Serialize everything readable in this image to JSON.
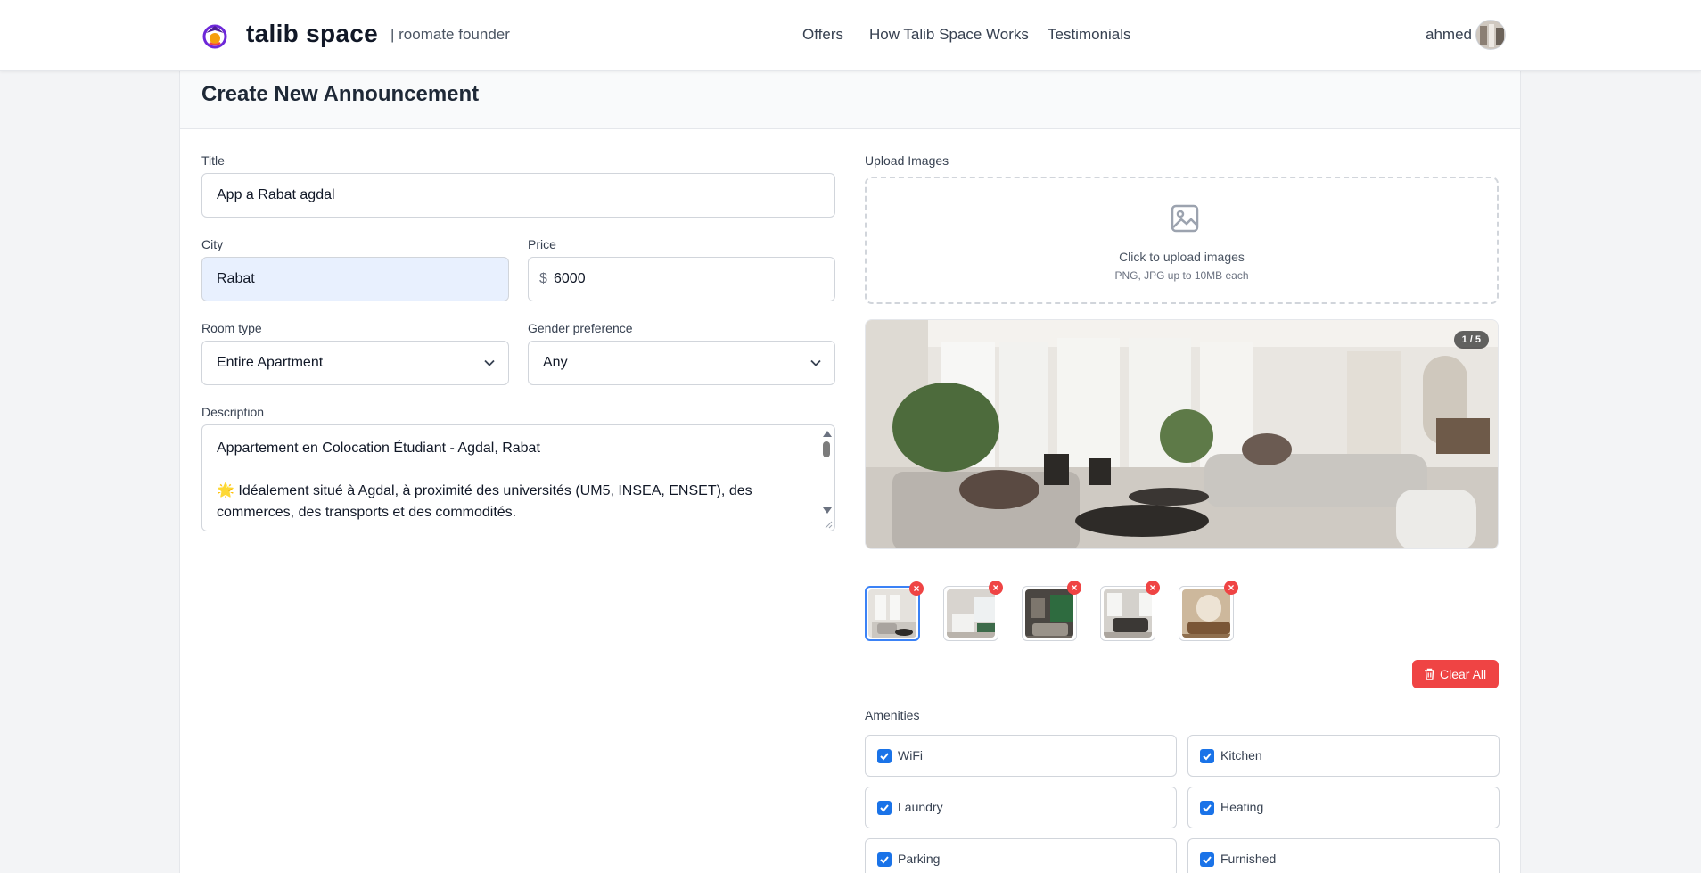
{
  "header": {
    "brand": "talib space",
    "tagline": "| roomate founder",
    "nav": [
      "Offers",
      "How Talib Space Works",
      "Testimonials"
    ],
    "user": "ahmed"
  },
  "page": {
    "title": "Create New Announcement"
  },
  "form": {
    "title_label": "Title",
    "title_value": "App a Rabat agdal",
    "city_label": "City",
    "city_value": "Rabat",
    "price_label": "Price",
    "price_currency": "$",
    "price_value": "6000",
    "room_type_label": "Room type",
    "room_type_value": "Entire Apartment",
    "gender_label": "Gender preference",
    "gender_value": "Any",
    "description_label": "Description",
    "description_line1": "Appartement en Colocation Étudiant - Agdal, Rabat",
    "description_line2": "🌟 Idéalement situé à Agdal, à proximité des universités (UM5, INSEA, ENSET), des commerces, des transports et des commodités."
  },
  "upload": {
    "label": "Upload Images",
    "cta": "Click to upload images",
    "hint": "PNG, JPG up to 10MB each",
    "counter": "1 / 5",
    "thumb_count": 5,
    "remove_symbol": "×",
    "clear_label": "Clear All"
  },
  "amenities": {
    "label": "Amenities",
    "items": [
      {
        "label": "WiFi",
        "checked": true
      },
      {
        "label": "Kitchen",
        "checked": true
      },
      {
        "label": "Laundry",
        "checked": true
      },
      {
        "label": "Heating",
        "checked": true
      },
      {
        "label": "Parking",
        "checked": true
      },
      {
        "label": "Furnished",
        "checked": true
      }
    ]
  },
  "colors": {
    "accent_blue": "#1a73e8",
    "danger_red": "#ef4444",
    "autofill_bg": "#e8f0fe"
  }
}
